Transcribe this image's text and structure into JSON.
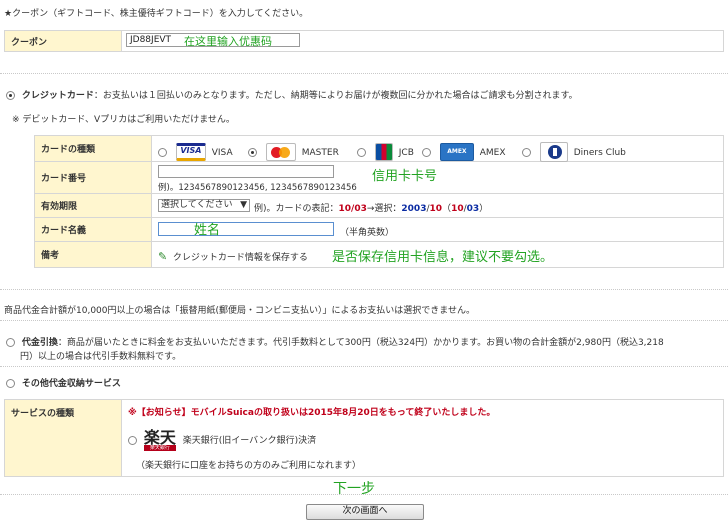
{
  "coupon": {
    "intro": "★クーポン（ギフトコード、株主優待ギフトコード）を入力してください。",
    "label": "クーポン",
    "value": "JD88JEVT",
    "annotation": "在这里输入优惠码"
  },
  "credit": {
    "title": "クレジットカード",
    "description": "：お支払いは１回払いのみとなります。ただし、納期等によりお届けが複数回に分かれた場合はご請求も分割されます。",
    "note": "※ デビットカード、Vプリカはご利用いただけません。",
    "rows": {
      "type_label": "カードの種類",
      "number_label": "カード番号",
      "expiry_label": "有効期限",
      "name_label": "カード名義",
      "remarks_label": "備考"
    },
    "brands": [
      "VISA",
      "MASTER",
      "JCB",
      "AMEX",
      "Diners Club"
    ],
    "number_example": "例)。1234567890123456, 1234567890123456",
    "number_annotation": "信用卡卡号",
    "expiry_select": "選択してください",
    "expiry_example_prefix": "例)。カードの表記：",
    "expiry_example_card": "10/03",
    "expiry_arrow": "→選択：",
    "expiry_example_year": "2003",
    "expiry_example_slash": "/",
    "expiry_example_month": "10",
    "expiry_example_paren_open": "（",
    "expiry_example_paren_month": "10",
    "expiry_example_paren_slash": "/",
    "expiry_example_paren_year": "03",
    "expiry_example_paren_close": "）",
    "name_annotation": "姓名",
    "name_hint": "（半角英数）",
    "save_card": "クレジットカード情報を保存する",
    "save_annotation": "是否保存信用卡信息，建议不要勾选。"
  },
  "notice_10000": "商品代金合計額が10,000円以上の場合は「振替用紙(郵便局・コンビニ支払い）」によるお支払いは選択できません。",
  "cod": {
    "title": "代金引換",
    "line1": "：商品が届いたときに料金をお支払いいただきます。代引手数料として300円（税込324円）かかります。お買い物の合計金額が2,980円（税込3,218",
    "line2": "円）以上の場合は代引手数料無料です。"
  },
  "other": {
    "title": "その他代金収納サービス",
    "service_label": "サービスの種類",
    "suica_notice": "※【お知らせ】モバイルSuicaの取り扱いは2015年8月20日をもって終了いたしました。",
    "rakuten_logo": "楽天",
    "rakuten_logo_sub": "楽天銀行",
    "rakuten_name": "楽天銀行(旧イーバンク銀行)決済",
    "rakuten_note": "（楽天銀行に口座をお持ちの方のみご利用になれます）"
  },
  "next_annotation": "下一步",
  "next_button": "次の画面へ",
  "colors": {
    "label_bg": "#fff6cf",
    "annotation": "#22a322",
    "notice_red": "#c0001a"
  }
}
